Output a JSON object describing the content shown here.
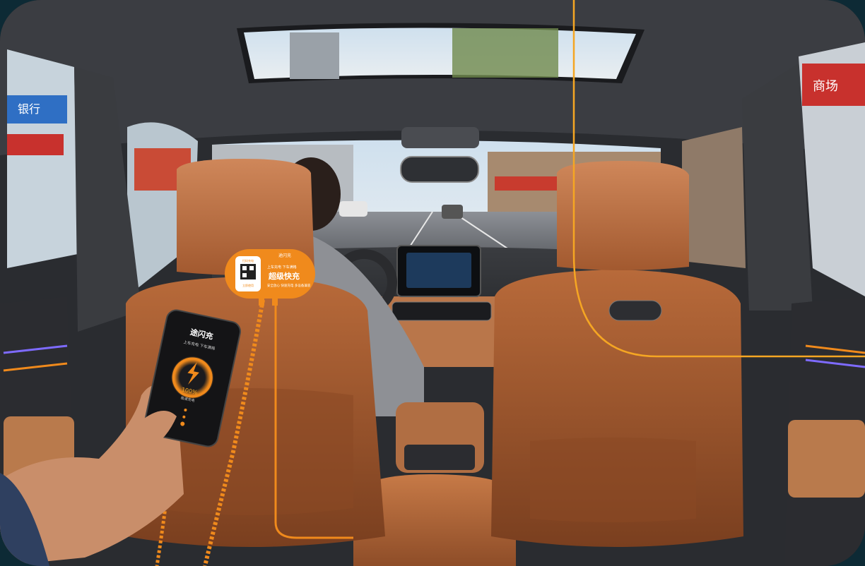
{
  "scene": {
    "description_free": true,
    "accent_color": "#f08a1c",
    "seat_color": "#b8683a",
    "frame_color": "#0d2a35"
  },
  "charger_device": {
    "brand": "途闪充",
    "headline": "超级快充",
    "slogan_top": "上车充电  下车满格",
    "footer_text": "安全放心  快速充电  多设备兼容",
    "qr_top_label": "扫码充电",
    "qr_bottom_label": "立即使用",
    "icon": "lightning-icon"
  },
  "phone_screen": {
    "brand": "途闪充",
    "subtitle": "上车充电  下车满格",
    "percent": "100%",
    "status": "极速充电",
    "charge_level": 1.0
  },
  "signs": {
    "left_building_sign": "银行",
    "right_building_sign": "商场"
  }
}
